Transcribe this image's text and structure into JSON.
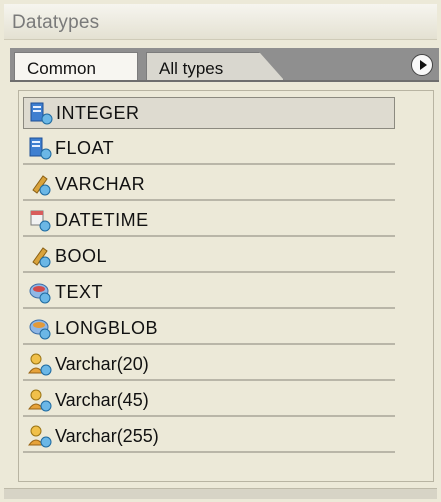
{
  "panel": {
    "title": "Datatypes"
  },
  "tabs": [
    {
      "label": "Common",
      "active": true
    },
    {
      "label": "All types",
      "active": false
    }
  ],
  "items": [
    {
      "label": "INTEGER",
      "icon": "numeric-type-icon",
      "selected": true
    },
    {
      "label": "FLOAT",
      "icon": "numeric-type-icon",
      "selected": false
    },
    {
      "label": "VARCHAR",
      "icon": "string-type-icon",
      "selected": false
    },
    {
      "label": "DATETIME",
      "icon": "datetime-type-icon",
      "selected": false
    },
    {
      "label": "BOOL",
      "icon": "string-type-icon",
      "selected": false
    },
    {
      "label": "TEXT",
      "icon": "blob-type-icon",
      "selected": false
    },
    {
      "label": "LONGBLOB",
      "icon": "blob-type-icon",
      "selected": false
    },
    {
      "label": "Varchar(20)",
      "icon": "user-type-icon",
      "selected": false
    },
    {
      "label": "Varchar(45)",
      "icon": "user-type-icon",
      "selected": false
    },
    {
      "label": "Varchar(255)",
      "icon": "user-type-icon",
      "selected": false
    }
  ],
  "colors": {
    "background": "#ece9d8",
    "tabbar": "#8f8f8f"
  }
}
